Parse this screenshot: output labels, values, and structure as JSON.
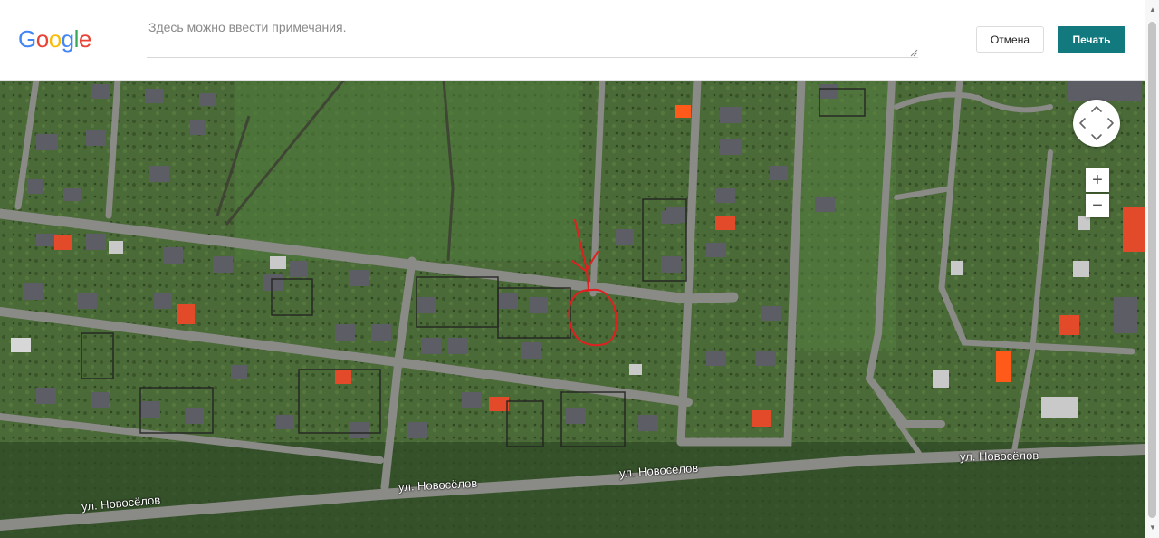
{
  "header": {
    "logo_letters": [
      {
        "ch": "G",
        "color": "#4285f4"
      },
      {
        "ch": "o",
        "color": "#ea4335"
      },
      {
        "ch": "o",
        "color": "#fbbc05"
      },
      {
        "ch": "g",
        "color": "#4285f4"
      },
      {
        "ch": "l",
        "color": "#34a853"
      },
      {
        "ch": "e",
        "color": "#ea4335"
      }
    ],
    "notes_placeholder": "Здесь можно ввести примечания.",
    "notes_value": "",
    "cancel_label": "Отмена",
    "print_label": "Печать",
    "print_color": "#12797f"
  },
  "map": {
    "street_labels": [
      "ул. Новосёлов",
      "ул. Новосёлов",
      "ул. Новосёлов",
      "ул. Новосёлов"
    ],
    "annotation_color": "#e02020",
    "controls": {
      "pan_icon": "pan-arrows-icon",
      "zoom_in": "+",
      "zoom_out": "−"
    }
  }
}
